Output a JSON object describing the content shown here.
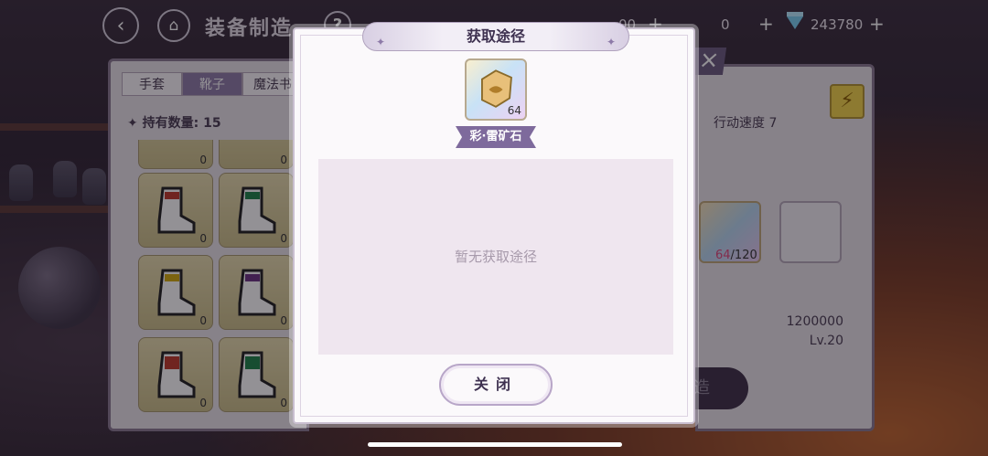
{
  "header": {
    "back_icon": "back-arrow-icon",
    "home_icon": "house-icon",
    "title": "装备制造",
    "help_icon": "question-icon",
    "currency_gold_partial": "00",
    "currency_middle": "0",
    "currency_diamond": "243780"
  },
  "inventory": {
    "tabs": [
      {
        "label": "手套",
        "active": false
      },
      {
        "label": "靴子",
        "active": true
      },
      {
        "label": "魔法书",
        "active": false
      }
    ],
    "owned_label": "持有数量: 15",
    "items": [
      {
        "count": "0",
        "color": "#c0392b"
      },
      {
        "count": "0",
        "color": "#1e8449"
      },
      {
        "count": "0",
        "color": "#c0392b"
      },
      {
        "count": "0",
        "color": "#1e8449"
      },
      {
        "count": "0",
        "color": "#d4ac0d"
      },
      {
        "count": "0",
        "color": "#6c3483"
      },
      {
        "count": "0",
        "color": "#c0392b"
      },
      {
        "count": "0",
        "color": "#1e8449"
      }
    ]
  },
  "equipment": {
    "speed_label": "行动速度 7",
    "material_have": "64",
    "material_need": "/120",
    "price": "1200000",
    "level": "Lv.20",
    "craft_label": "造"
  },
  "modal": {
    "title": "获取途径",
    "item_quantity": "64",
    "item_name": "彩·雷矿石",
    "empty_text": "暂无获取途径",
    "close_label": "关闭"
  }
}
